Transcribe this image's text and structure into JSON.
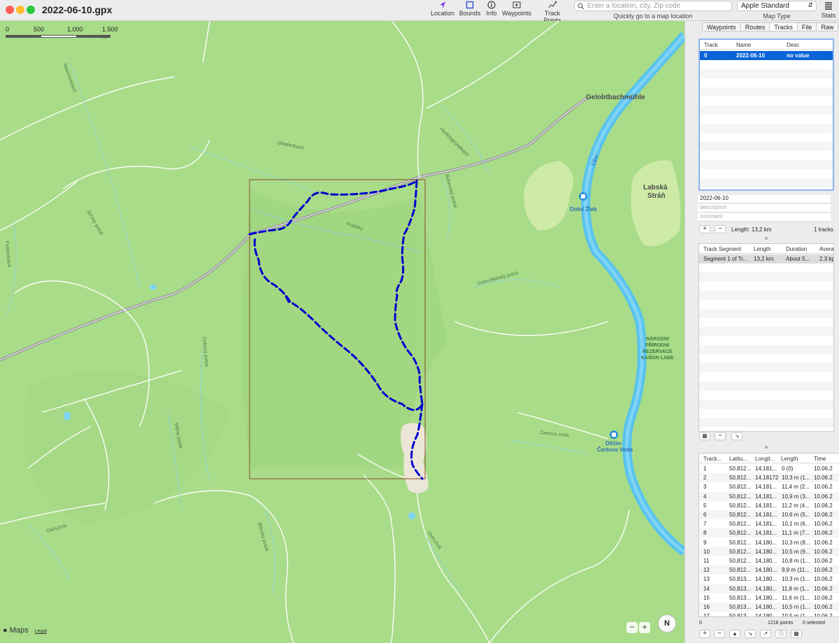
{
  "window": {
    "title": "2022-06-10.gpx"
  },
  "toolbar": {
    "location": "Location",
    "bounds": "Bounds",
    "info": "Info",
    "waypoints": "Waypoints",
    "track_points": "Track Points",
    "search_placeholder": "Enter a location, city, Zip code",
    "search_hint": "Quickly go to a map location",
    "map_type_value": "Apple Standard",
    "map_type_label": "Map Type",
    "stats": "Stats"
  },
  "map": {
    "scale_labels": [
      "0",
      "500",
      "1.000",
      "1.500 m"
    ],
    "places": {
      "gelobt": "Gelobtbachmühle",
      "labska_1": "Labská",
      "labska_2": "Stráň",
      "dolni_zleb": "Dolní Žleb",
      "decin_1": "Děčín-",
      "decin_2": "Čertova Voda",
      "npr_1": "NÁRODNÍ",
      "npr_2": "PŘÍRODNÍ",
      "npr_3": "REZERVACE",
      "npr_4": "KAŇON LABE",
      "elbe": "Elbe"
    },
    "streams": {
      "naschenbach": "Naschenbach",
      "gliedenbach": "Gliedenbach",
      "herfelsgrund": "Herfelsgrundbach",
      "jezovy_potok": "Ježový potok",
      "fuckenbach": "Fuckenbach",
      "polacky": "Poláčky",
      "bobovsky": "Bobovský potok",
      "dolnozlebsky": "Dolnožlebský potok",
      "dubovy": "Dubový potok",
      "mlyny": "Mlýny potok",
      "certova": "Čertova voda",
      "ostruznik1": "Ostružník",
      "bansky": "Bánský potok",
      "ostruznik2": "Ostružník"
    },
    "attribution": "Maps",
    "legal": "Legal",
    "compass": "N",
    "colors": {
      "land": "#a8dc88",
      "track": "#0000cc",
      "bounds": "#8b4a2a",
      "river": "#5ec8ef"
    }
  },
  "sidebar": {
    "tabs": [
      "Waypoints",
      "Routes",
      "Tracks",
      "File",
      "Raw"
    ],
    "selected_tab": "Tracks",
    "tracks_table": {
      "headers": [
        "Track",
        "Name",
        "Desc"
      ],
      "rows": [
        {
          "track": "0",
          "name": "2022-06-10",
          "desc": "no value"
        }
      ]
    },
    "track_name": "2022-06-10",
    "description_placeholder": "description",
    "comment_placeholder": "comment",
    "length_text": "Length: 13,2 km",
    "tracks_count": "1 tracks",
    "segments_table": {
      "headers": [
        "Track Segment",
        "Length",
        "Duration",
        "Avera"
      ],
      "rows": [
        {
          "segment": "Segment 1 of Tr...",
          "length": "13,2 km",
          "duration": "About 5...",
          "avg": "2.3 kp"
        }
      ]
    },
    "points_table": {
      "headers": [
        "Track...",
        "Latitu...",
        "Longit...",
        "Length",
        "Time"
      ],
      "rows": [
        [
          "1",
          "50,812...",
          "14,181...",
          "0 (0)",
          "10.06.2"
        ],
        [
          "2",
          "50,812...",
          "14,18172",
          "10,3 m (1...",
          "10.06.2"
        ],
        [
          "3",
          "50,812...",
          "14,181...",
          "11,4 m (2...",
          "10.06.2"
        ],
        [
          "4",
          "50,812...",
          "14,181...",
          "10,9 m (3...",
          "10.06.2"
        ],
        [
          "5",
          "50,812...",
          "14,181...",
          "11,2 m (4...",
          "10.06.2"
        ],
        [
          "6",
          "50,812...",
          "14,181...",
          "10,6 m (5...",
          "10.06.2"
        ],
        [
          "7",
          "50,812...",
          "14,181...",
          "10,1 m (6...",
          "10.06.2"
        ],
        [
          "8",
          "50,812...",
          "14,181...",
          "11,1 m (7...",
          "10.06.2"
        ],
        [
          "9",
          "50,812...",
          "14,180...",
          "10,3 m (8...",
          "10.06.2"
        ],
        [
          "10",
          "50,812...",
          "14,180...",
          "10,5 m (9...",
          "10.06.2"
        ],
        [
          "11",
          "50,812...",
          "14,180...",
          "10,8 m (1...",
          "10.06.2"
        ],
        [
          "12",
          "50,812...",
          "14,180...",
          "9,9 m (11...",
          "10.06.2"
        ],
        [
          "13",
          "50,813...",
          "14,180...",
          "10,3 m (1...",
          "10.06.2"
        ],
        [
          "14",
          "50,813...",
          "14,180...",
          "11,8 m (1...",
          "10.06.2"
        ],
        [
          "15",
          "50,813...",
          "14,180...",
          "11,6 m (1...",
          "10.06.2"
        ],
        [
          "16",
          "50,813...",
          "14,180...",
          "10,5 m (1...",
          "10.06.2"
        ],
        [
          "17",
          "50,813...",
          "14,180...",
          "10,5 m (1...",
          "10.06.2"
        ]
      ]
    },
    "points_footer": {
      "left": "0",
      "points": "1218 points",
      "selected": "0 selected"
    }
  }
}
